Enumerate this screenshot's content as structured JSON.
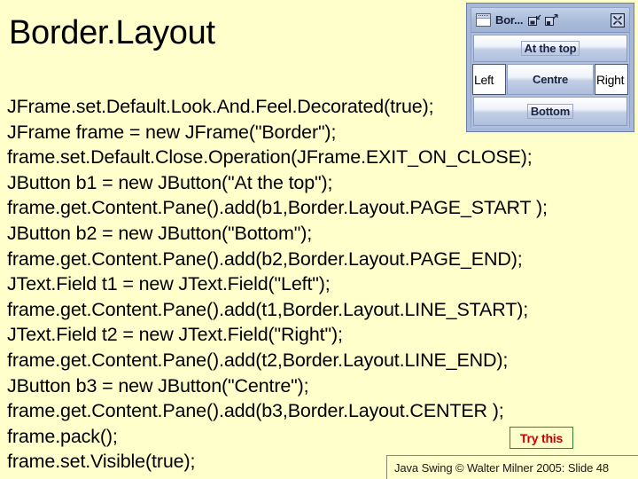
{
  "slide": {
    "title": "Border.Layout",
    "background_color": "#ffffcc",
    "text_color": "#000000"
  },
  "code": {
    "lines": [
      "JFrame.set.Default.Look.And.Feel.Decorated(true);",
      "JFrame frame = new JFrame(\"Border\");",
      "frame.set.Default.Close.Operation(JFrame.EXIT_ON_CLOSE);",
      "JButton b1 = new JButton(\"At the top\");",
      "frame.get.Content.Pane().add(b1,Border.Layout.PAGE_START );",
      "JButton b2 = new JButton(\"Bottom\");",
      "frame.get.Content.Pane().add(b2,Border.Layout.PAGE_END);",
      "JText.Field t1 = new JText.Field(\"Left\");",
      "frame.get.Content.Pane().add(t1,Border.Layout.LINE_START);",
      "JText.Field t2 = new JText.Field(\"Right\");",
      "frame.get.Content.Pane().add(t2,Border.Layout.LINE_END);",
      "JButton b3 = new JButton(\"Centre\");",
      "frame.get.Content.Pane().add(b3,Border.Layout.CENTER );",
      "frame.pack();",
      "frame.set.Visible(true);"
    ]
  },
  "swing_window": {
    "title": "Bor...",
    "title_bar_buttons": {
      "minimize": "minimize-icon",
      "maximize": "maximize-icon",
      "close": "close-icon"
    },
    "window_icon": "window-icon",
    "page_start_button": "At the top",
    "line_start_textfield": "Left",
    "center_button": "Centre",
    "line_end_textfield": "Right",
    "page_end_button": "Bottom",
    "frame_color": "#a8b8d8",
    "titlebar_color": "#a9bbd9"
  },
  "try_this": {
    "label": "Try this",
    "text_color": "#cc0000",
    "border_color": "#2d8a2d"
  },
  "footer": {
    "text": "Java Swing © Walter Milner 2005: Slide 48"
  }
}
